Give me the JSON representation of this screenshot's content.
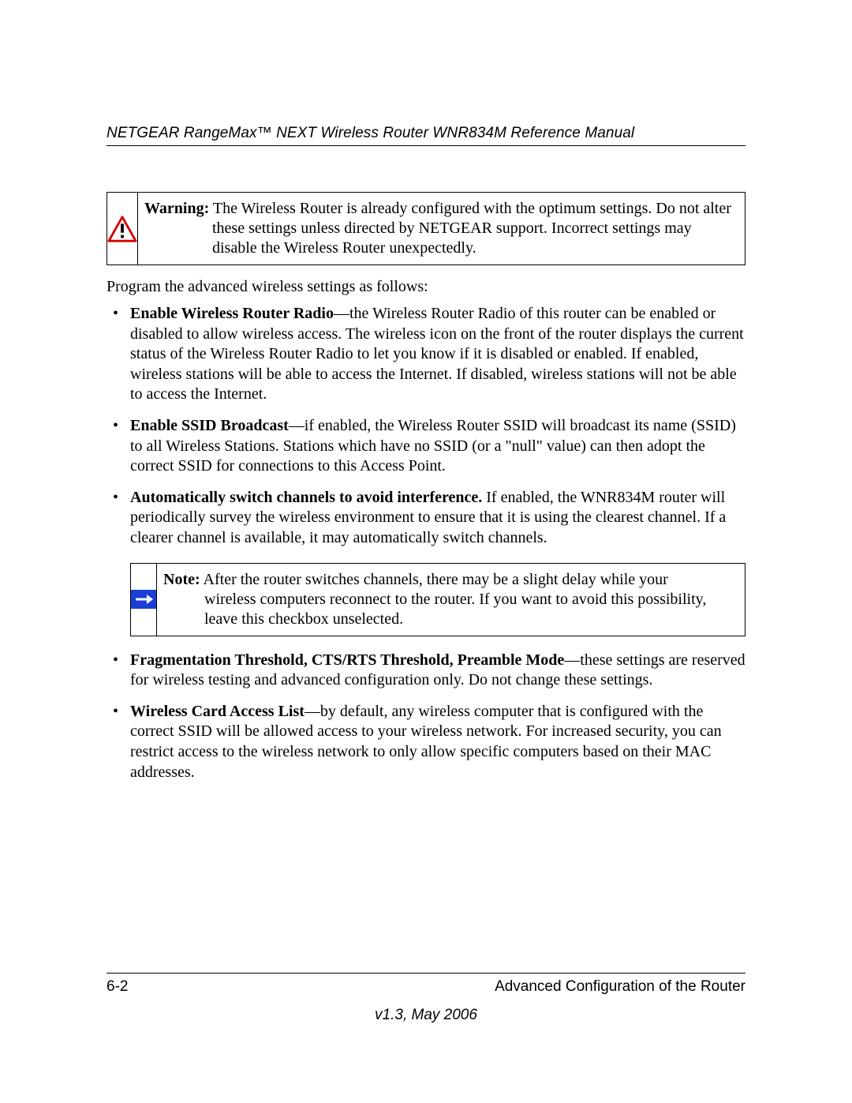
{
  "header": {
    "title": "NETGEAR RangeMax™ NEXT Wireless Router WNR834M Reference Manual"
  },
  "warning": {
    "label": "Warning:",
    "text": "The Wireless Router is already configured with the optimum settings. Do not alter these settings unless directed by NETGEAR support. Incorrect settings may disable the Wireless Router unexpectedly."
  },
  "intro": "Program the advanced wireless settings as follows:",
  "bullets": [
    {
      "bold": "Enable Wireless Router Radio",
      "text": "—the Wireless Router Radio of this router can be enabled or disabled to allow wireless access. The wireless icon on the front of the router displays the current status of the Wireless Router Radio to let you know if it is disabled or enabled. If enabled, wireless stations will be able to access the Internet. If disabled, wireless stations will not be able to access the Internet."
    },
    {
      "bold": "Enable SSID Broadcast",
      "text": "—if enabled, the Wireless Router SSID will broadcast its name (SSID) to all Wireless Stations. Stations which have no SSID (or a \"null\" value) can then adopt the correct SSID for connections to this Access Point."
    },
    {
      "bold": "Automatically switch channels to avoid interference.",
      "text": " If enabled, the WNR834M router will periodically survey the wireless environment to ensure that it is using the clearest channel. If a clearer channel is available, it may automatically switch channels."
    },
    {
      "bold": "Fragmentation Threshold, CTS/RTS Threshold, Preamble Mode",
      "text": "—these settings are reserved for wireless testing and advanced configuration only. Do not change these settings."
    },
    {
      "bold": "Wireless Card Access List",
      "text": "—by default, any wireless computer that is configured with the correct SSID will be allowed access to your wireless network. For increased security, you can restrict access to the wireless network to only allow specific computers based on their MAC addresses."
    }
  ],
  "note": {
    "label": "Note:",
    "text": "After the router switches channels, there may be a slight delay while your wireless computers reconnect to the router. If you want to avoid this possibility, leave this checkbox unselected."
  },
  "footer": {
    "page": "6-2",
    "section": "Advanced Configuration of the Router",
    "version": "v1.3, May 2006"
  }
}
